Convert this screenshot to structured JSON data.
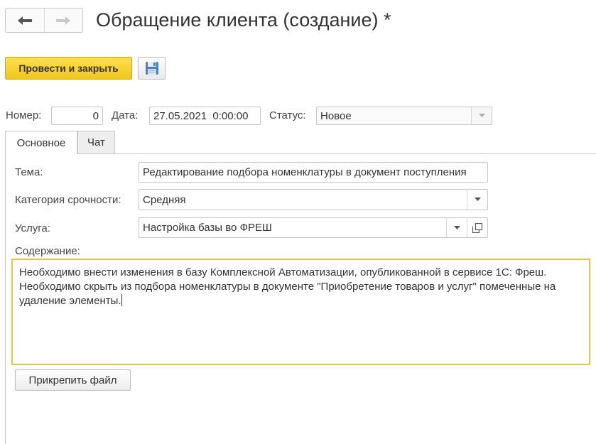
{
  "window": {
    "title": "Обращение клиента (создание) *"
  },
  "toolbar": {
    "post_close_label": "Провести и закрыть",
    "save_icon": "floppy-disk-icon"
  },
  "nav": {
    "back_icon": "arrow-left-icon",
    "forward_icon": "arrow-right-icon"
  },
  "header": {
    "number_label": "Номер:",
    "number_value": "0",
    "date_label": "Дата:",
    "date_value": "27.05.2021  0:00:00",
    "status_label": "Статус:",
    "status_value": "Новое"
  },
  "tabs": [
    {
      "label": "Основное",
      "active": true
    },
    {
      "label": "Чат",
      "active": false
    }
  ],
  "form": {
    "subject_label": "Тема:",
    "subject_value": "Редактирование подбора номенклатуры в документ поступления",
    "urgency_label": "Категория срочности:",
    "urgency_value": "Средняя",
    "service_label": "Услуга:",
    "service_value": "Настройка базы во ФРЕШ",
    "content_label": "Содержание:",
    "content_value": "Необходимо внести изменения в базу Комплексной Автоматизации, опубликованной в сервисе 1С: Фреш. Необходимо скрыть из подбора номенклатуры в документе \"Приобретение товаров и услуг\" помеченные на удаление элементы.",
    "attach_label": "Прикрепить файл"
  },
  "colors": {
    "primary_button": "#f5cb22",
    "focus_border": "#e7c83c",
    "border": "#c6c6c6"
  }
}
